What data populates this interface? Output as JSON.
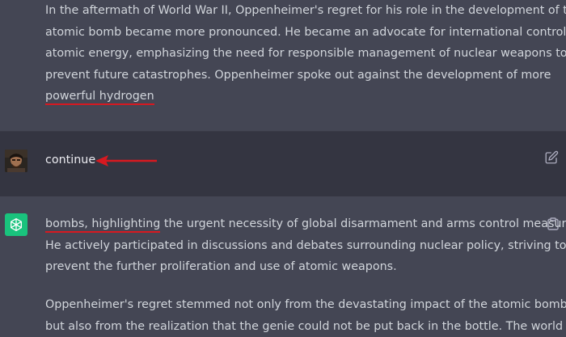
{
  "previous_message": {
    "lines": [
      "In the aftermath of World War II, Oppenheimer's regret for his role in the development of the",
      "atomic bomb became more pronounced. He became an advocate for international control of",
      "atomic energy, emphasizing the need for responsible management of nuclear weapons to",
      "prevent future catastrophes. Oppenheimer spoke out against the development of more"
    ],
    "highlighted_end": "powerful hydrogen"
  },
  "user_message": {
    "text": "continue"
  },
  "assistant_message": {
    "highlighted_start": "bombs, highlighting",
    "first_line_rest": " the urgent necessity of global disarmament and arms control measures.",
    "lines": [
      "He actively participated in discussions and debates surrounding nuclear policy, striving to",
      "prevent the further proliferation and use of atomic weapons."
    ],
    "paragraph2_lines": [
      "Oppenheimer's regret stemmed not only from the devastating impact of the atomic bomb",
      "but also from the realization that the genie could not be put back in the bottle. The world had"
    ]
  },
  "icons": {
    "edit": "edit-icon",
    "copy": "clipboard-icon",
    "assistant_avatar": "openai-logo-icon",
    "annotation": "red-arrow-icon"
  },
  "colors": {
    "annotation_red": "#d71920",
    "assistant_avatar_bg": "#19c37d",
    "user_row_bg": "#343541",
    "assistant_row_bg": "#444654"
  }
}
